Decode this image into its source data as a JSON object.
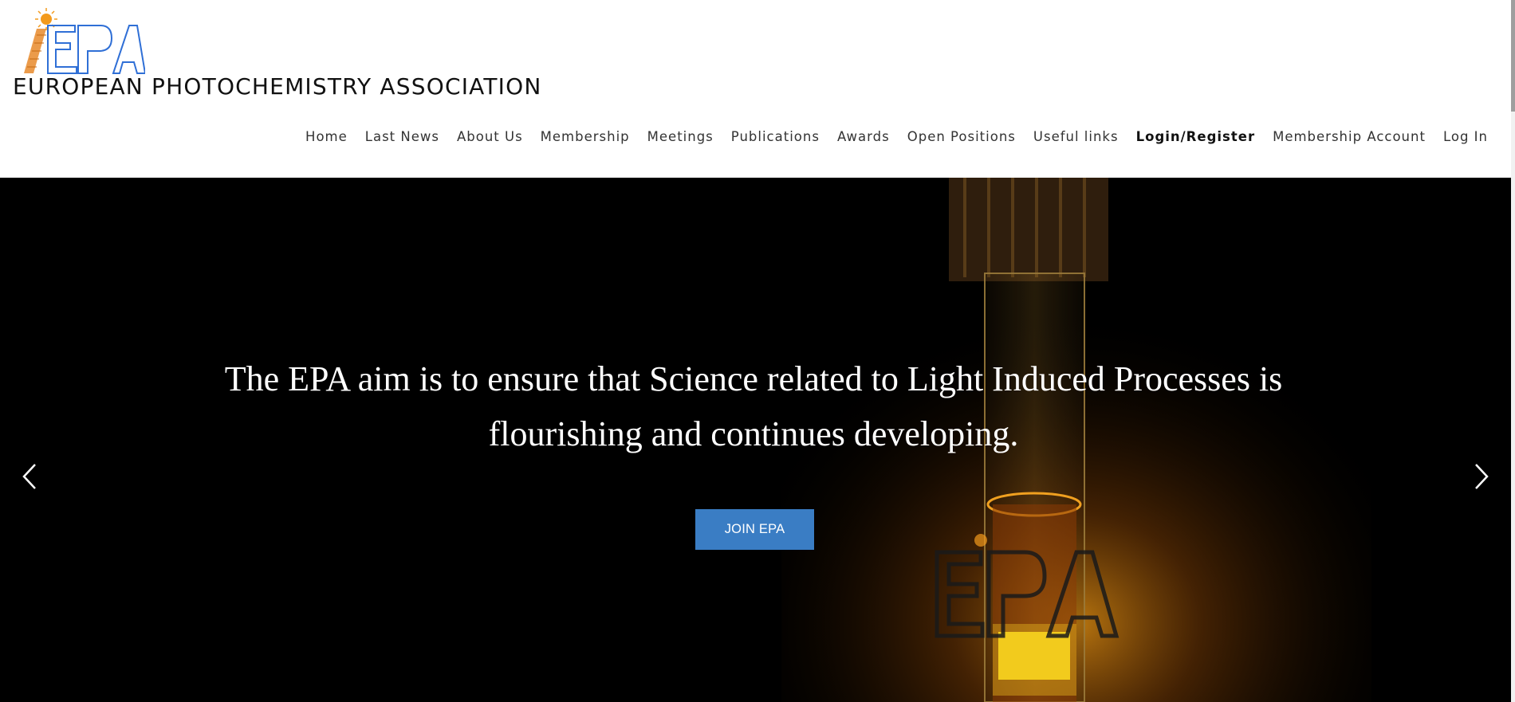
{
  "site": {
    "title": "EUROPEAN PHOTOCHEMISTRY ASSOCIATION",
    "logo_text": "EPA"
  },
  "nav": {
    "items": [
      {
        "label": "Home"
      },
      {
        "label": "Last News"
      },
      {
        "label": "About Us"
      },
      {
        "label": "Membership"
      },
      {
        "label": "Meetings"
      },
      {
        "label": "Publications"
      },
      {
        "label": "Awards"
      },
      {
        "label": "Open Positions"
      },
      {
        "label": "Useful links"
      },
      {
        "label": "Login/Register",
        "active": true
      },
      {
        "label": "Membership Account"
      },
      {
        "label": "Log In"
      }
    ]
  },
  "hero": {
    "headline": "The EPA aim is to ensure that Science related to Light Induced Processes is flourishing and continues developing.",
    "cta_label": "JOIN EPA",
    "prev_icon": "chevron-left-icon",
    "next_icon": "chevron-right-icon"
  },
  "colors": {
    "accent": "#3a7dc4",
    "hero_bg": "#000000",
    "logo_blue": "#2f6fd6",
    "logo_orange": "#e8892b"
  }
}
